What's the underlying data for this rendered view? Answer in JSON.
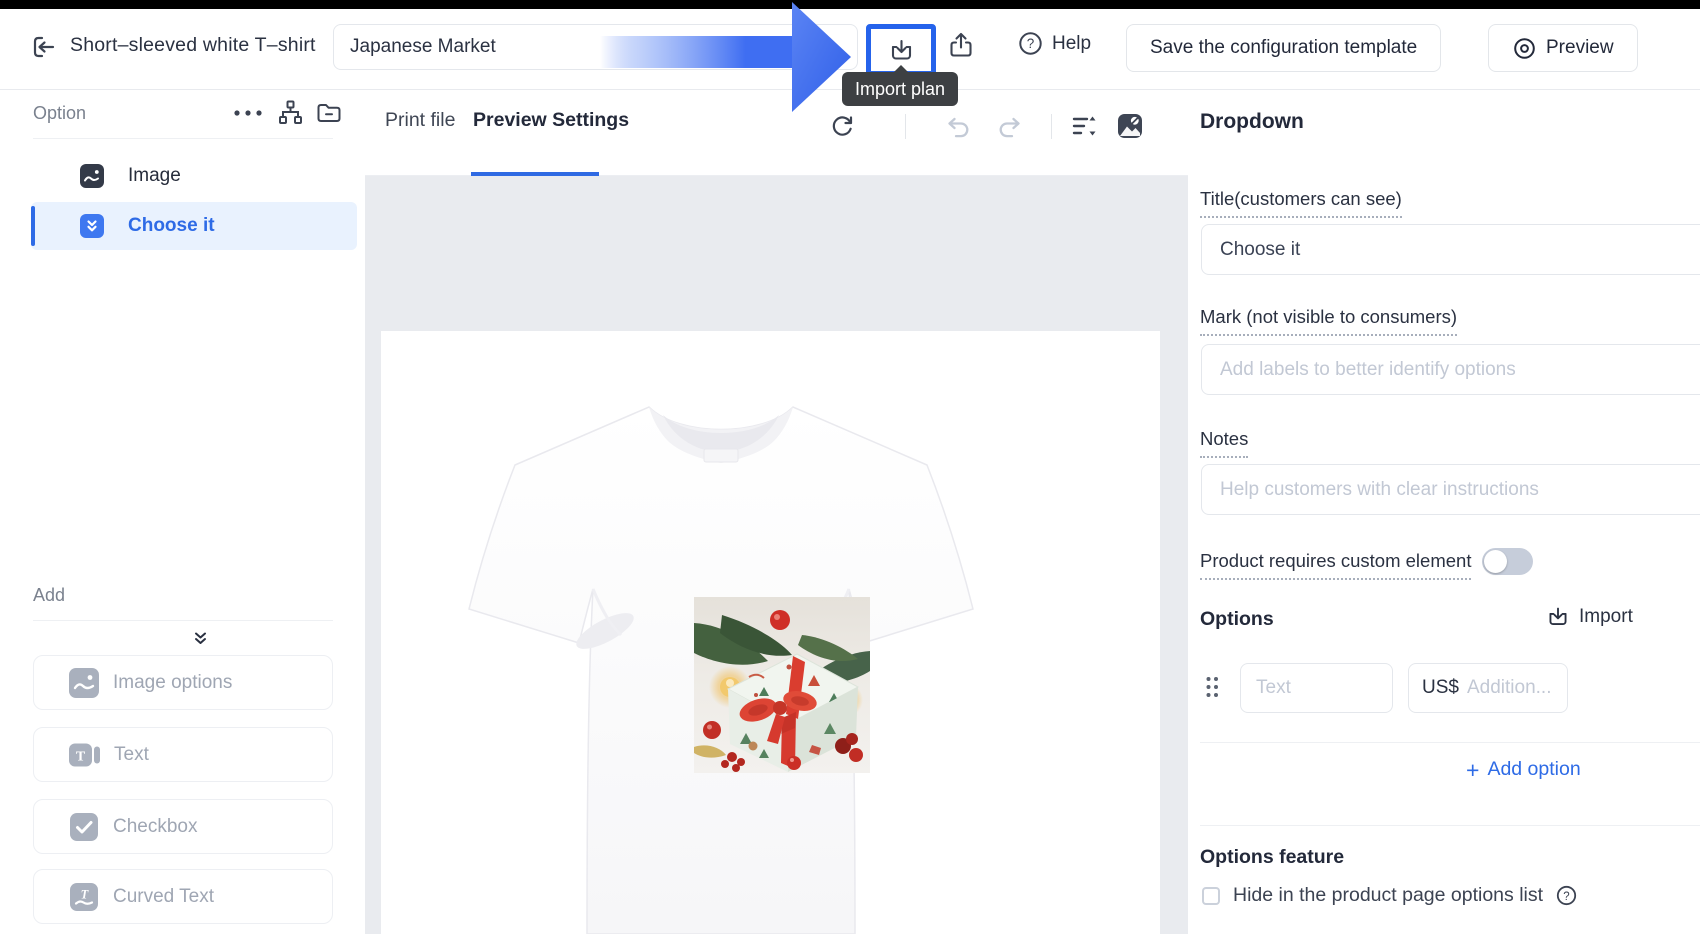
{
  "colors": {
    "accent": "#2E6BE6",
    "highlight_border": "#2563EB",
    "arrow_blue": "#3F6EF2",
    "tooltip_bg": "#3D4043",
    "canvas_bg": "#E9EBEF",
    "selected_row_bg": "#E9F2FE",
    "disabled_icon_bg": "#A9B0BD"
  },
  "topbar": {
    "title": "Short–sleeved white T–shirt",
    "market_input": {
      "value": "Japanese Market"
    },
    "import_tooltip": "Import plan",
    "help_label": "Help",
    "save_button": "Save the configuration template",
    "preview_button": "Preview"
  },
  "sidebar": {
    "header": "Option",
    "items": [
      {
        "label": "Image",
        "selected": false
      },
      {
        "label": "Choose it",
        "selected": true
      }
    ],
    "add": {
      "label": "Add",
      "buttons": [
        {
          "label": "Image options"
        },
        {
          "label": "Text"
        },
        {
          "label": "Checkbox"
        },
        {
          "label": "Curved Text"
        }
      ]
    }
  },
  "workspace": {
    "tabs": [
      {
        "label": "Print file",
        "active": false
      },
      {
        "label": "Preview Settings",
        "active": true
      }
    ],
    "canvas": {
      "product": "white short-sleeved t-shirt photo",
      "overlay": "christmas gift box photo"
    }
  },
  "panel": {
    "heading": "Dropdown",
    "title_field": {
      "label": "Title(customers can see)",
      "value": "Choose it"
    },
    "mark_field": {
      "label": "Mark (not visible to consumers)",
      "placeholder": "Add labels to better identify options"
    },
    "notes_field": {
      "label": "Notes",
      "placeholder": "Help customers with clear instructions"
    },
    "custom_element_toggle": {
      "label": "Product requires custom element",
      "state": "off"
    },
    "options": {
      "label": "Options",
      "import_label": "Import",
      "row": {
        "text_placeholder": "Text",
        "currency": "US$",
        "price_placeholder": "Addition..."
      },
      "plus": "+",
      "add_option_label": "Add option"
    },
    "feature": {
      "heading": "Options feature",
      "checkbox_label": "Hide in the product page options list",
      "checked": false,
      "question_glyph": "?"
    }
  }
}
